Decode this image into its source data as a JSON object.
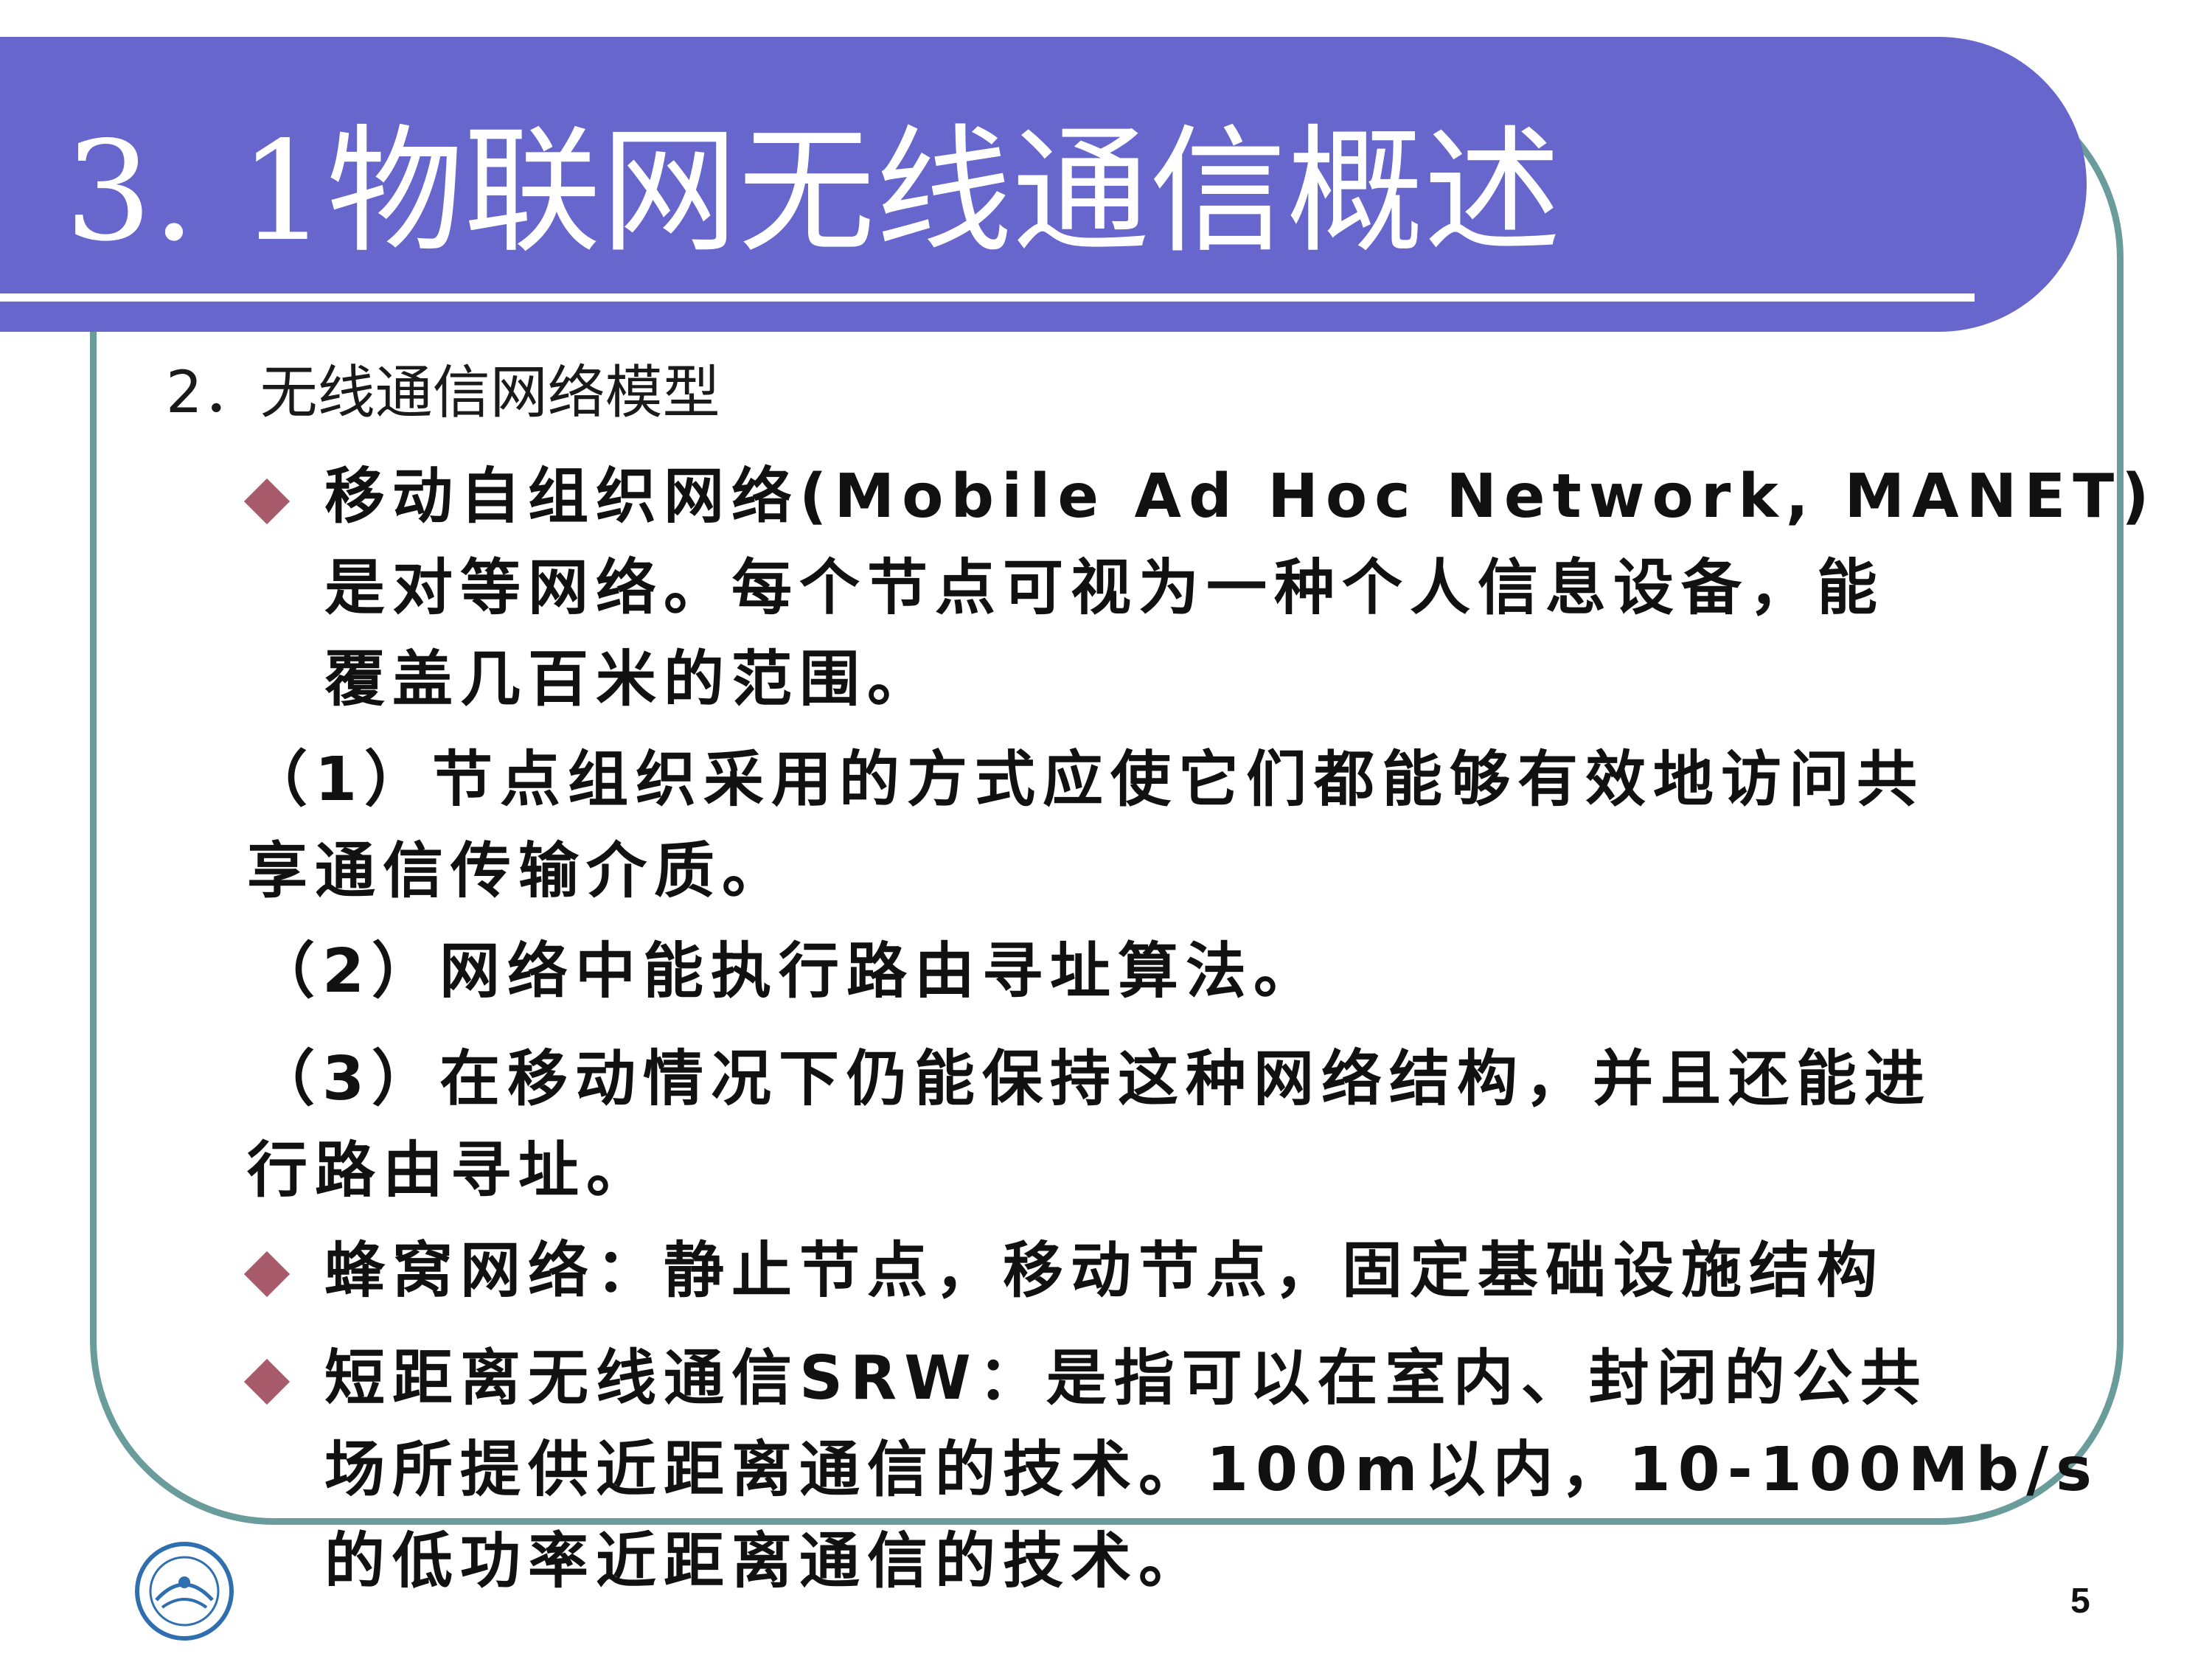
{
  "slide": {
    "title": "3. 1物联网无线通信概述",
    "subheading": "2．无线通信网络模型",
    "manet": {
      "line1": "移动自组织网络(Mobile Ad Hoc Network, MANET)",
      "line2": "是对等网络。每个节点可视为一种个人信息设备，能",
      "line3": "覆盖几百米的范围。"
    },
    "point1": {
      "line1": "（1）节点组织采用的方式应使它们都能够有效地访问共",
      "line2": "享通信传输介质。"
    },
    "point2": {
      "line1": "（2）网络中能执行路由寻址算法。"
    },
    "point3": {
      "line1": "（3）在移动情况下仍能保持这种网络结构，并且还能进",
      "line2": "行路由寻址。"
    },
    "cellular": {
      "line1": "蜂窝网络：静止节点，移动节点，固定基础设施结构"
    },
    "srw": {
      "line1": "短距离无线通信SRW：是指可以在室内、封闭的公共",
      "line2": "场所提供近距离通信的技术。100m以内，10-100Mb/s",
      "line3": "的低功率近距离通信的技术。"
    },
    "page_number": "5"
  },
  "colors": {
    "banner": "#6666cc",
    "frame": "#6a9c9c",
    "bullet": "#a65a6a",
    "title_text": "#ffffff",
    "body_text": "#111111"
  },
  "icons": {
    "bullet": "diamond-bullet-icon",
    "logo": "university-logo-icon"
  }
}
